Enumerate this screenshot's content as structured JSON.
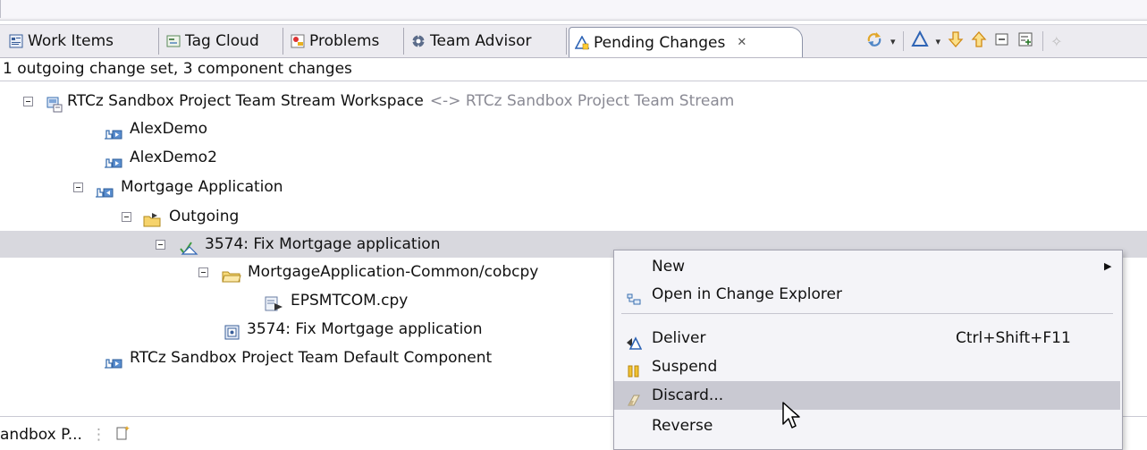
{
  "tabs": [
    {
      "label": "Work Items",
      "icon": "work-items-icon"
    },
    {
      "label": "Tag Cloud",
      "icon": "tag-cloud-icon"
    },
    {
      "label": "Problems",
      "icon": "problems-icon"
    },
    {
      "label": "Team Advisor",
      "icon": "gear-icon"
    },
    {
      "label": "Pending Changes",
      "icon": "pending-changes-icon",
      "active": true,
      "close": "✕"
    }
  ],
  "summary": "1 outgoing change set, 3 component changes",
  "tree": {
    "workspace": {
      "label": "RTCz Sandbox Project Team Stream Workspace",
      "suffix": "<-> RTCz Sandbox Project Team Stream"
    },
    "components": [
      "AlexDemo",
      "AlexDemo2"
    ],
    "mortgage": "Mortgage Application",
    "outgoing": "Outgoing",
    "changeset": "3574: Fix Mortgage application",
    "folder": "MortgageApplication-Common/cobcpy",
    "file": "EPSMTCOM.cpy",
    "workitem": "3574: Fix Mortgage application",
    "default_component": "RTCz Sandbox Project Team Default Component"
  },
  "menu": {
    "new": "New",
    "open_change_explorer": "Open in Change Explorer",
    "deliver": "Deliver",
    "deliver_shortcut": "Ctrl+Shift+F11",
    "suspend": "Suspend",
    "discard": "Discard...",
    "reverse": "Reverse"
  },
  "status": {
    "label": "andbox P..."
  },
  "colors": {
    "accent": "#3a6fb0",
    "selection": "#d8d8de",
    "menu_hover": "#c9c9d2"
  }
}
